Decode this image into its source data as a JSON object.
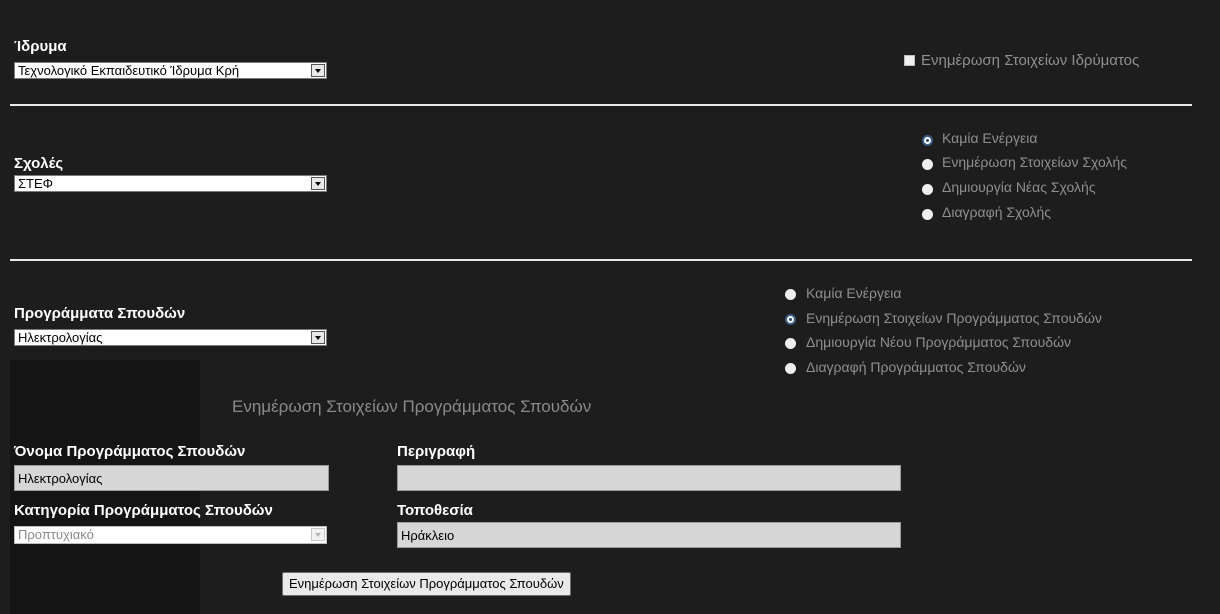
{
  "institution": {
    "label": "Ίδρυμα",
    "selected": "Τεχνολογικό Εκπαιδευτικό Ίδρυμα Κρή",
    "update_checkbox_label": "Ενημέρωση Στοιχείων Ιδρύματος"
  },
  "schools": {
    "label": "Σχολές",
    "selected": "ΣΤΕΦ",
    "actions": [
      {
        "label": "Καμία Ενέργεια",
        "checked": true
      },
      {
        "label": "Ενημέρωση Στοιχείων Σχολής",
        "checked": false
      },
      {
        "label": "Δημιουργία Νέας Σχολής",
        "checked": false
      },
      {
        "label": "Διαγραφή Σχολής",
        "checked": false
      }
    ]
  },
  "programs": {
    "label": "Προγράμματα Σπουδών",
    "selected": "Ηλεκτρολογίας",
    "actions": [
      {
        "label": "Καμία Ενέργεια",
        "checked": false
      },
      {
        "label": "Ενημέρωση Στοιχείων Προγράμματος Σπουδών",
        "checked": true
      },
      {
        "label": "Δημιουργία Νέου Προγράμματος Σπουδών",
        "checked": false
      },
      {
        "label": "Διαγραφή Προγράμματος Σπουδών",
        "checked": false
      }
    ]
  },
  "form": {
    "title": "Ενημέρωση Στοιχείων Προγράμματος Σπουδών",
    "name_label": "Όνομα Προγράμματος Σπουδών",
    "name_value": "Ηλεκτρολογίας",
    "description_label": "Περιγραφή",
    "description_value": "",
    "category_label": "Κατηγορία Προγράμματος Σπουδών",
    "category_value": "Προπτυχιακό",
    "location_label": "Τοποθεσία",
    "location_value": "Ηράκλειο",
    "submit_label": "Ενημέρωση Στοιχείων Προγράμματος Σπουδών"
  }
}
